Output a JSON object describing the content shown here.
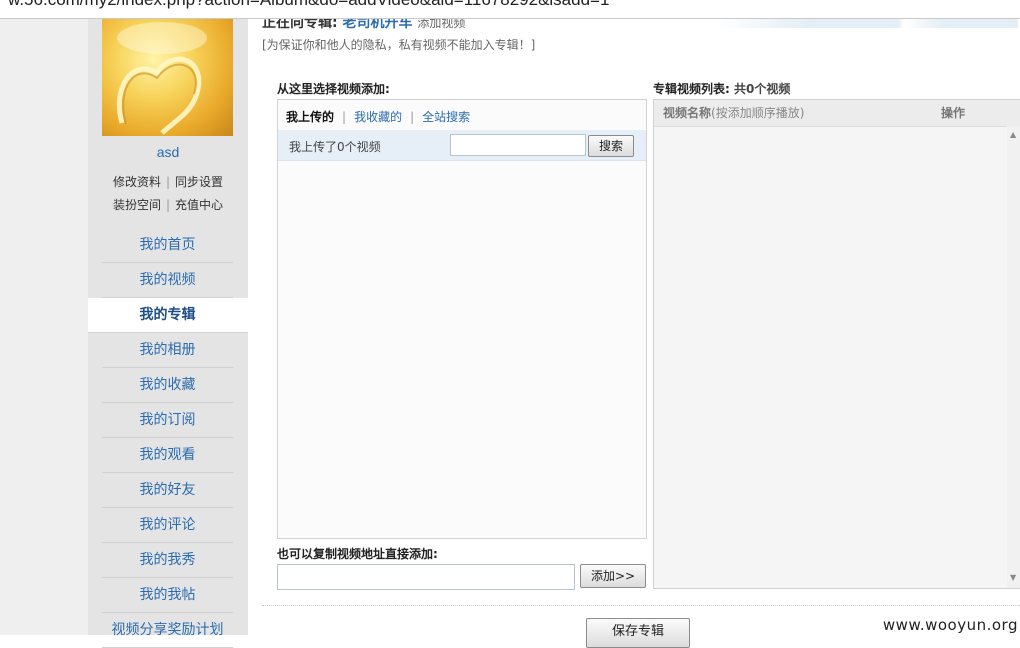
{
  "browser": {
    "url": "w.56.com/my2/index.php?action=Album&do=addVideo&aid=11678292&isadd=1"
  },
  "sidebar": {
    "username": "asd",
    "links_row1": [
      "修改资料",
      "同步设置"
    ],
    "links_row2": [
      "装扮空间",
      "充值中心"
    ],
    "items": [
      {
        "label": "我的首页"
      },
      {
        "label": "我的视频"
      },
      {
        "label": "我的专辑",
        "active": true
      },
      {
        "label": "我的相册"
      },
      {
        "label": "我的收藏"
      },
      {
        "label": "我的订阅"
      },
      {
        "label": "我的观看"
      },
      {
        "label": "我的好友"
      },
      {
        "label": "我的评论"
      },
      {
        "label": "我的我秀"
      },
      {
        "label": "我的我帖"
      },
      {
        "label": "视频分享奖励计划"
      }
    ]
  },
  "header": {
    "title_prefix": "正在向专辑:",
    "album_name": "老司机开车",
    "title_suffix": "添加视频",
    "privacy_note": "[为保证你和他人的隐私，私有视频不能加入专辑！]"
  },
  "left_panel": {
    "section_title": "从这里选择视频添加:",
    "tabs": [
      {
        "label": "我上传的",
        "current": true
      },
      {
        "label": "我收藏的"
      },
      {
        "label": "全站搜索"
      }
    ],
    "upload_count_text": "我上传了0个视频",
    "search_value": "",
    "search_button": "搜索"
  },
  "right_panel": {
    "title": "专辑视频列表:",
    "count_text": "共0个视频",
    "col_name": "视频名称",
    "col_name_note": "(按添加顺序播放)",
    "col_action": "操作"
  },
  "copy_add": {
    "title": "也可以复制视频地址直接添加:",
    "url_value": "",
    "add_button": "添加>>"
  },
  "save_button": "保存专辑",
  "watermark": "www.wooyun.org",
  "colors": {
    "link": "#2b6cb0",
    "sidebar_bg": "#e4e4e4",
    "active_item_bg": "#ffffff"
  }
}
